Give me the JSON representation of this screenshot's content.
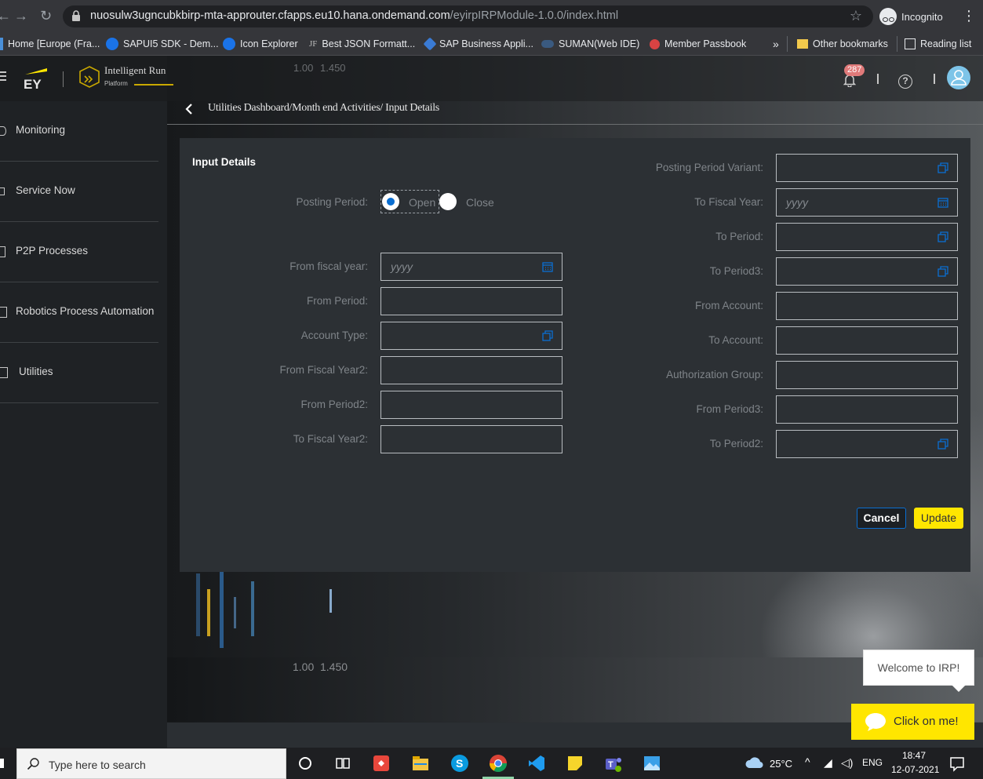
{
  "browser": {
    "url_host": "nuosulw3ugncubkbirp-mta-approuter.cfapps.eu10.hana.ondemand.com",
    "url_path": "/eyirpIRPModule-1.0.0/index.html",
    "profile_label": "Incognito",
    "bookmarks": [
      {
        "label": "Home [Europe (Fra...",
        "icon": "sap-icon"
      },
      {
        "label": "SAPUI5 SDK - Dem...",
        "icon": "globe-icon"
      },
      {
        "label": "Icon Explorer",
        "icon": "globe-icon"
      },
      {
        "label": "Best JSON Formatt...",
        "icon": "jf-icon"
      },
      {
        "label": "SAP Business Appli...",
        "icon": "sap-bas-icon"
      },
      {
        "label": "SUMAN(Web IDE)",
        "icon": "cloud-icon"
      },
      {
        "label": "Member Passbook",
        "icon": "epfo-icon"
      }
    ],
    "bookmarks_overflow": "»",
    "other_bookmarks": "Other bookmarks",
    "reading_list": "Reading list",
    "jf_mark": "JF"
  },
  "app": {
    "brand_mark": "EY",
    "product_name": "Intelligent Run",
    "product_sub": "Platform",
    "notification_count": "287",
    "help_glyph": "?",
    "sidebar": [
      {
        "label": "Monitoring"
      },
      {
        "label": "Service Now"
      },
      {
        "label": "P2P Processes"
      },
      {
        "label": "Robotics Process Automation"
      },
      {
        "label": "Utilities"
      }
    ],
    "breadcrumb": "Utilities Dashboard/Month end Activities/ Input Details",
    "background_numbers": [
      "1.00",
      "1.450",
      "1.00",
      "1.450"
    ]
  },
  "dialog": {
    "title": "Input Details",
    "posting_period": {
      "label": "Posting Period:",
      "options": [
        "Open",
        "Close"
      ],
      "selected": "Open"
    },
    "left_fields": [
      {
        "label": "From fiscal year:",
        "value": "",
        "placeholder": "yyyy",
        "icon": "calendar-icon"
      },
      {
        "label": "From Period:",
        "value": "",
        "placeholder": "",
        "icon": ""
      },
      {
        "label": "Account Type:",
        "value": "",
        "placeholder": "",
        "icon": "value-help-icon"
      },
      {
        "label": "From Fiscal Year2:",
        "value": "",
        "placeholder": "",
        "icon": ""
      },
      {
        "label": "From Period2:",
        "value": "",
        "placeholder": "",
        "icon": ""
      },
      {
        "label": "To Fiscal Year2:",
        "value": "",
        "placeholder": "",
        "icon": ""
      }
    ],
    "right_fields": [
      {
        "label": "Posting Period Variant:",
        "value": "",
        "placeholder": "",
        "icon": "value-help-icon"
      },
      {
        "label": "To Fiscal Year:",
        "value": "",
        "placeholder": "yyyy",
        "icon": "calendar-icon"
      },
      {
        "label": "To Period:",
        "value": "",
        "placeholder": "",
        "icon": "value-help-icon"
      },
      {
        "label": "To Period3:",
        "value": "",
        "placeholder": "",
        "icon": "value-help-icon"
      },
      {
        "label": "From Account:",
        "value": "",
        "placeholder": "",
        "icon": ""
      },
      {
        "label": "To Account:",
        "value": "",
        "placeholder": "",
        "icon": ""
      },
      {
        "label": "Authorization Group:",
        "value": "",
        "placeholder": "",
        "icon": ""
      },
      {
        "label": "From Period3:",
        "value": "",
        "placeholder": "",
        "icon": ""
      },
      {
        "label": "To Period2:",
        "value": "",
        "placeholder": "",
        "icon": "value-help-icon"
      }
    ],
    "cancel_label": "Cancel",
    "update_label": "Update"
  },
  "chatbot": {
    "welcome": "Welcome to IRP!",
    "cta": "Click on me!"
  },
  "taskbar": {
    "search_placeholder": "Type here to search",
    "weather": "25°C",
    "language": "ENG",
    "time": "18:47",
    "date": "12-07-2021"
  },
  "colors": {
    "accent_yellow": "#ffe600",
    "accent_blue": "#0a6ed1",
    "dialog_bg": "#2c3034"
  }
}
